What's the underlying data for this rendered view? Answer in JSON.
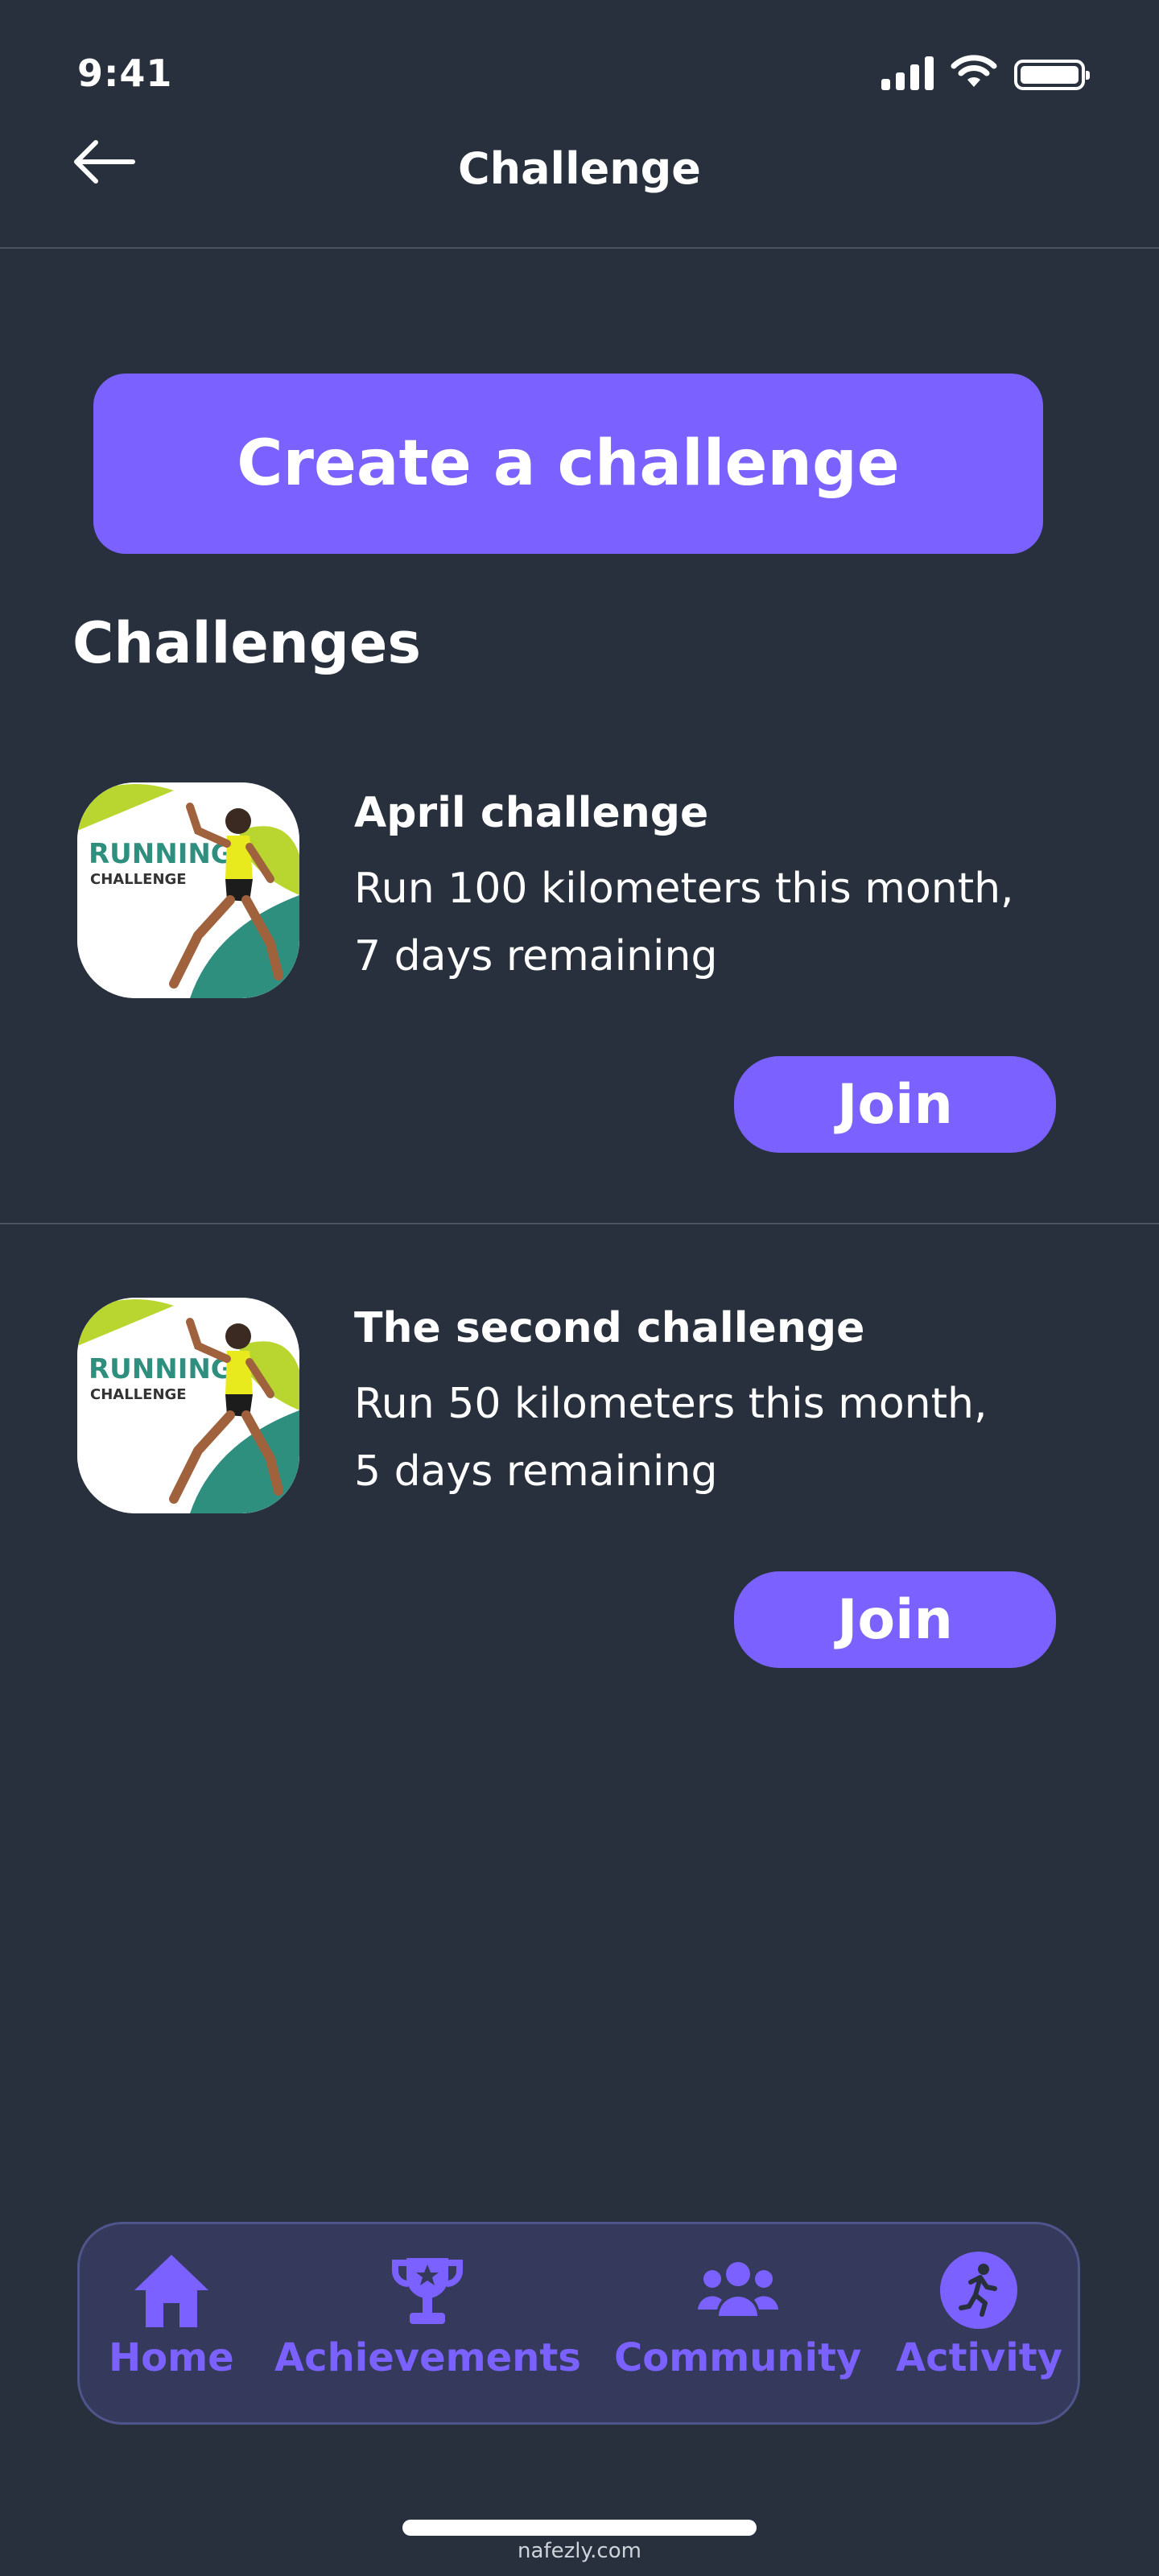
{
  "status_bar": {
    "time": "9:41"
  },
  "header": {
    "title": "Challenge",
    "back_icon": "arrow-left-icon"
  },
  "create_button": {
    "label": "Create a challenge"
  },
  "section": {
    "title": "Challenges"
  },
  "challenges": [
    {
      "title": "April challenge",
      "description_line1": "Run 100 kilometers this month,",
      "description_line2": "7 days remaining",
      "thumb_text1": "RUNNING",
      "thumb_text2": "CHALLENGE",
      "join_label": "Join"
    },
    {
      "title": "The second challenge",
      "description_line1": "Run 50 kilometers this month,",
      "description_line2": "5 days remaining",
      "thumb_text1": "RUNNING",
      "thumb_text2": "CHALLENGE",
      "join_label": "Join"
    }
  ],
  "bottom_nav": {
    "items": [
      {
        "label": "Home",
        "icon": "home-icon"
      },
      {
        "label": "Achievements",
        "icon": "trophy-icon"
      },
      {
        "label": "Community",
        "icon": "community-icon"
      },
      {
        "label": "Activity",
        "icon": "running-icon"
      }
    ]
  },
  "watermark": "nafezly.com",
  "colors": {
    "background": "#27303c",
    "accent": "#7b61ff",
    "nav_background": "#353a5c"
  }
}
